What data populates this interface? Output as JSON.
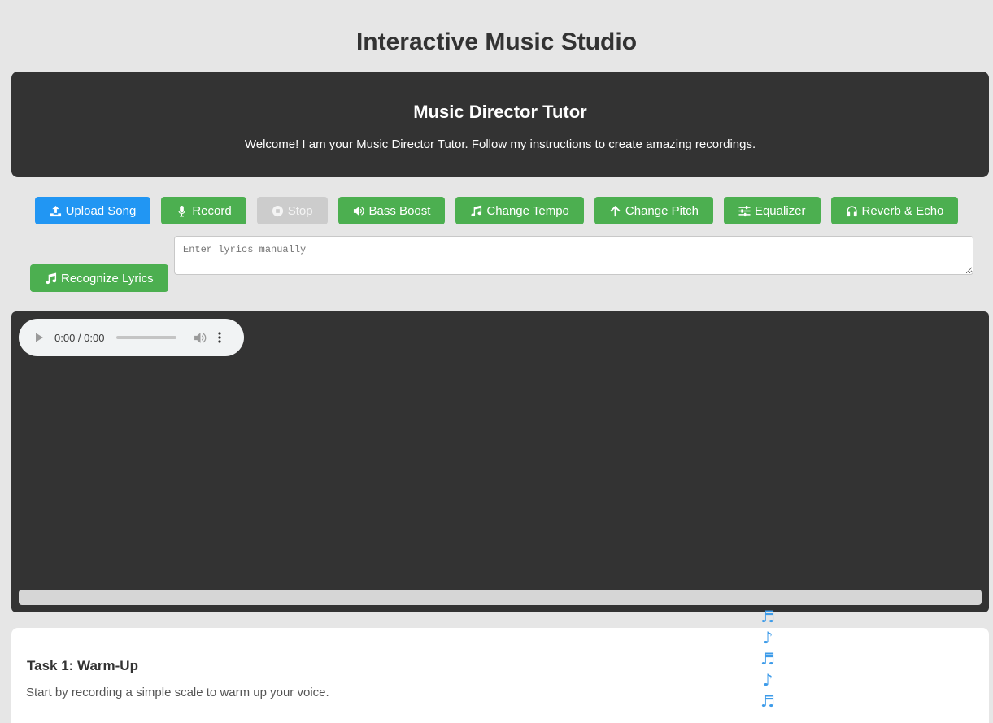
{
  "page": {
    "title": "Interactive Music Studio"
  },
  "tutor": {
    "title": "Music Director Tutor",
    "message": "Welcome! I am your Music Director Tutor. Follow my instructions to create amazing recordings."
  },
  "controls": {
    "upload": "Upload Song",
    "record": "Record",
    "stop": "Stop",
    "bass_boost": "Bass Boost",
    "change_tempo": "Change Tempo",
    "change_pitch": "Change Pitch",
    "equalizer": "Equalizer",
    "reverb_echo": "Reverb & Echo",
    "recognize_lyrics": "Recognize Lyrics"
  },
  "lyrics": {
    "placeholder": "Enter lyrics manually",
    "value": ""
  },
  "audio": {
    "time": "0:00 / 0:00",
    "progress": 0
  },
  "task": {
    "title": "Task 1: Warm-Up",
    "description": "Start by recording a simple scale to warm up your voice."
  },
  "notes": [
    "♬",
    "♪",
    "♬",
    "♪",
    "♬"
  ],
  "colors": {
    "background": "#e6e6e6",
    "panel": "#333333",
    "green": "#4caf50",
    "blue": "#2196f3",
    "disabled": "#cccccc",
    "note": "#3d9be9"
  }
}
